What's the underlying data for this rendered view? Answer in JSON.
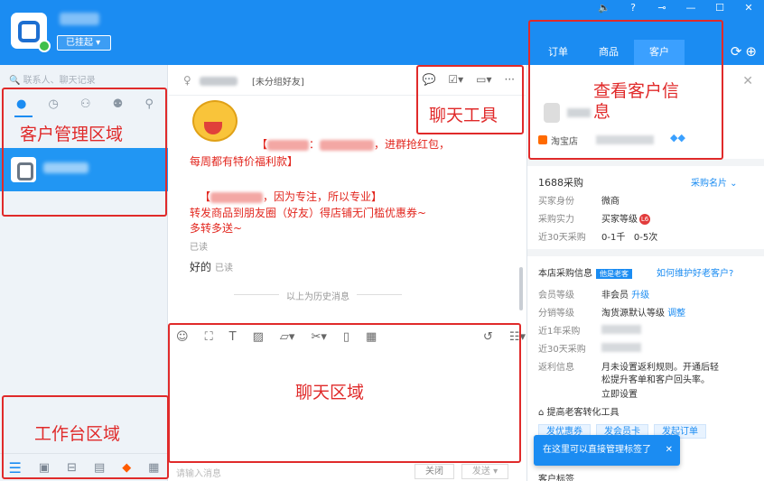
{
  "header": {
    "status": "已挂起",
    "right_tabs": [
      "订单",
      "商品",
      "客户"
    ],
    "active_tab": "客户"
  },
  "left": {
    "search_placeholder": "联系人、聊天记录"
  },
  "chat": {
    "group_label": "[未分组好友]",
    "messages": {
      "line1": "，进群抢红包，",
      "line1b": "每周都有特价福利款】",
      "line2": "，因为专注，所以专业】",
      "line3": "转发商品到朋友圈（好友）得店铺无门槛优惠券~",
      "line4": "多转多送~",
      "read": "已读",
      "plain_text": "好的",
      "plain_read": "已读"
    },
    "history": "以上为历史消息",
    "input_placeholder": "请输入消息",
    "close_btn": "关闭",
    "send_btn": "发送"
  },
  "right": {
    "shop": "淘宝店",
    "purchase_title": "1688采购",
    "purchase_link": "采购名片",
    "buyer_label": "买家身份",
    "buyer_value": "微商",
    "strength_label": "采购实力",
    "strength_value": "买家等级",
    "recent_label": "近30天采购",
    "recent_value1": "0-1千",
    "recent_value2": "0-5次",
    "store_info": "本店采购信息",
    "store_tag": "他是老客",
    "store_link": "如何维护好老客户?",
    "member_label": "会员等级",
    "member_value": "非会员",
    "member_link": "升级",
    "dist_label": "分销等级",
    "dist_value": "淘货源默认等级",
    "dist_link": "调整",
    "year_label": "近1年采购",
    "month_label": "近30天采购",
    "rebate_label": "返利信息",
    "rebate_text1": "月未设置返利规则。开通后轻",
    "rebate_text2": "松提升客单和客户回头率。",
    "rebate_link": "立即设置",
    "tools_title": "提高老客转化工具",
    "tools": [
      "发优惠券",
      "发会员卡",
      "发起订单"
    ],
    "tags_title": "客户标签",
    "tip": "在这里可以直接管理标签了"
  },
  "annotations": {
    "customer_mgmt": "客户管理区域",
    "chat_tools": "聊天工具",
    "view_customer": "查看客户信息",
    "chat_area": "聊天区域",
    "workbench": "工作台区域"
  }
}
